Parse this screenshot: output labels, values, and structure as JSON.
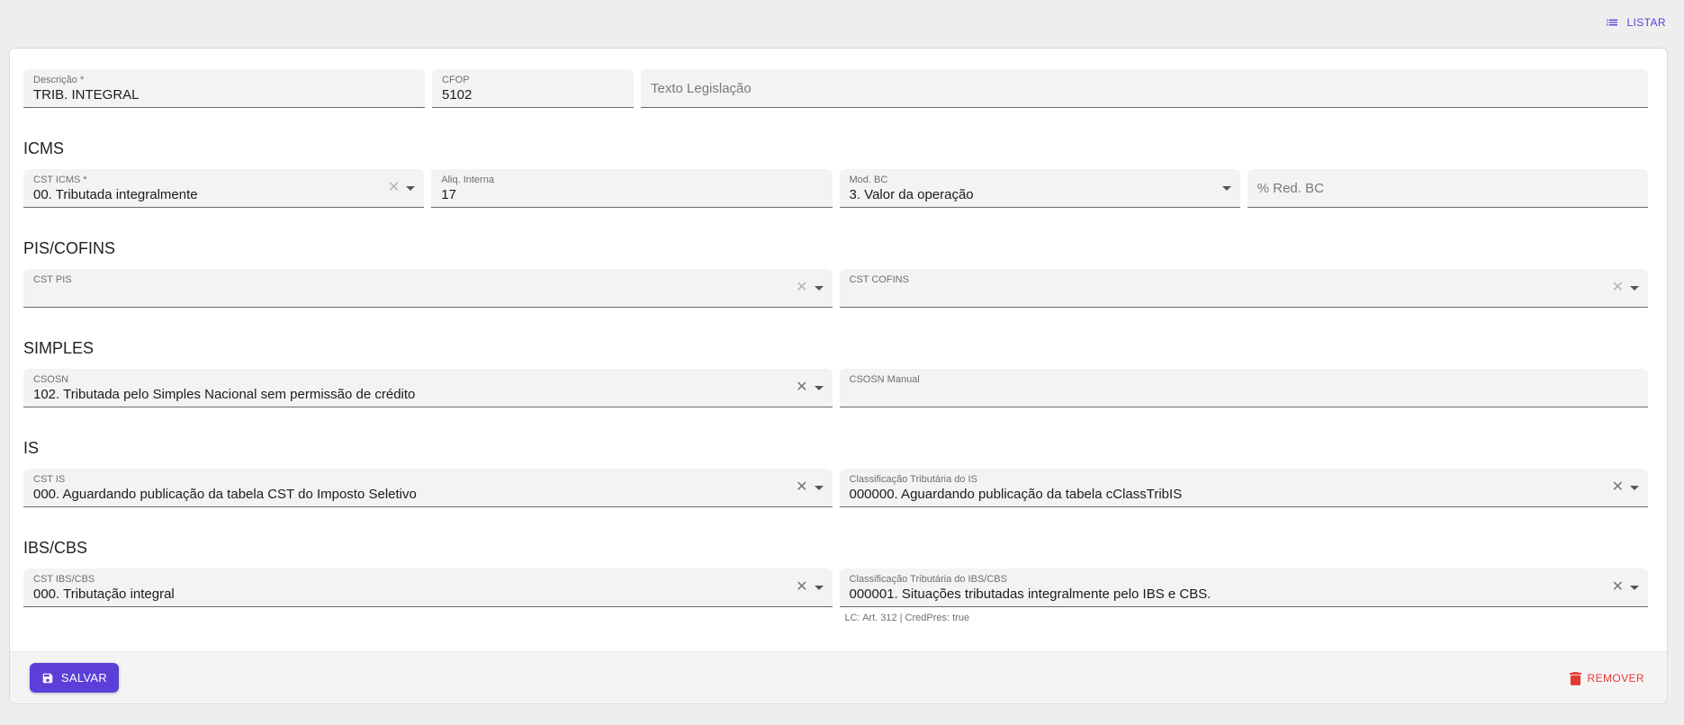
{
  "header": {
    "list_label": "LISTAR",
    "list_icon": "list-icon"
  },
  "general": {
    "descricao": {
      "label": "Descrição *",
      "value": "TRIB. INTEGRAL"
    },
    "cfop": {
      "label": "CFOP",
      "value": "5102"
    },
    "texto_legislacao": {
      "placeholder": "Texto Legislação"
    }
  },
  "icms": {
    "title": "ICMS",
    "cst_icms": {
      "label": "CST ICMS *",
      "value": "00. Tributada integralmente"
    },
    "aliq_interna": {
      "label": "Aliq. Interna",
      "value": "17"
    },
    "mod_bc": {
      "label": "Mod. BC",
      "value": "3. Valor da operação"
    },
    "red_bc": {
      "placeholder": "% Red. BC"
    }
  },
  "pis_cofins": {
    "title": "PIS/COFINS",
    "cst_pis": {
      "label": "CST PIS",
      "value": ""
    },
    "cst_cofins": {
      "label": "CST COFINS",
      "value": ""
    }
  },
  "simples": {
    "title": "SIMPLES",
    "csosn": {
      "label": "CSOSN",
      "value": "102. Tributada pelo Simples Nacional sem permissão de crédito"
    },
    "csosn_manual": {
      "label": "CSOSN Manual",
      "value": ""
    }
  },
  "is": {
    "title": "IS",
    "cst_is": {
      "label": "CST IS",
      "value": "000. Aguardando publicação da tabela CST do Imposto Seletivo"
    },
    "class_trib_is": {
      "label": "Classificação Tributária do IS",
      "value": "000000. Aguardando publicação da tabela cClassTribIS"
    }
  },
  "ibs_cbs": {
    "title": "IBS/CBS",
    "cst_ibs_cbs": {
      "label": "CST IBS/CBS",
      "value": "000. Tributação integral"
    },
    "class_trib_ibs_cbs": {
      "label": "Classificação Tributária do IBS/CBS",
      "value": "000001. Situações tributadas integralmente pelo IBS e CBS.",
      "hint": "LC: Art. 312 | CredPres: true"
    }
  },
  "footer": {
    "save_label": "SALVAR",
    "remove_label": "REMOVER"
  },
  "colors": {
    "accent": "#5b3fd8",
    "danger": "#e53935",
    "field_bg": "#f3f3f3"
  }
}
